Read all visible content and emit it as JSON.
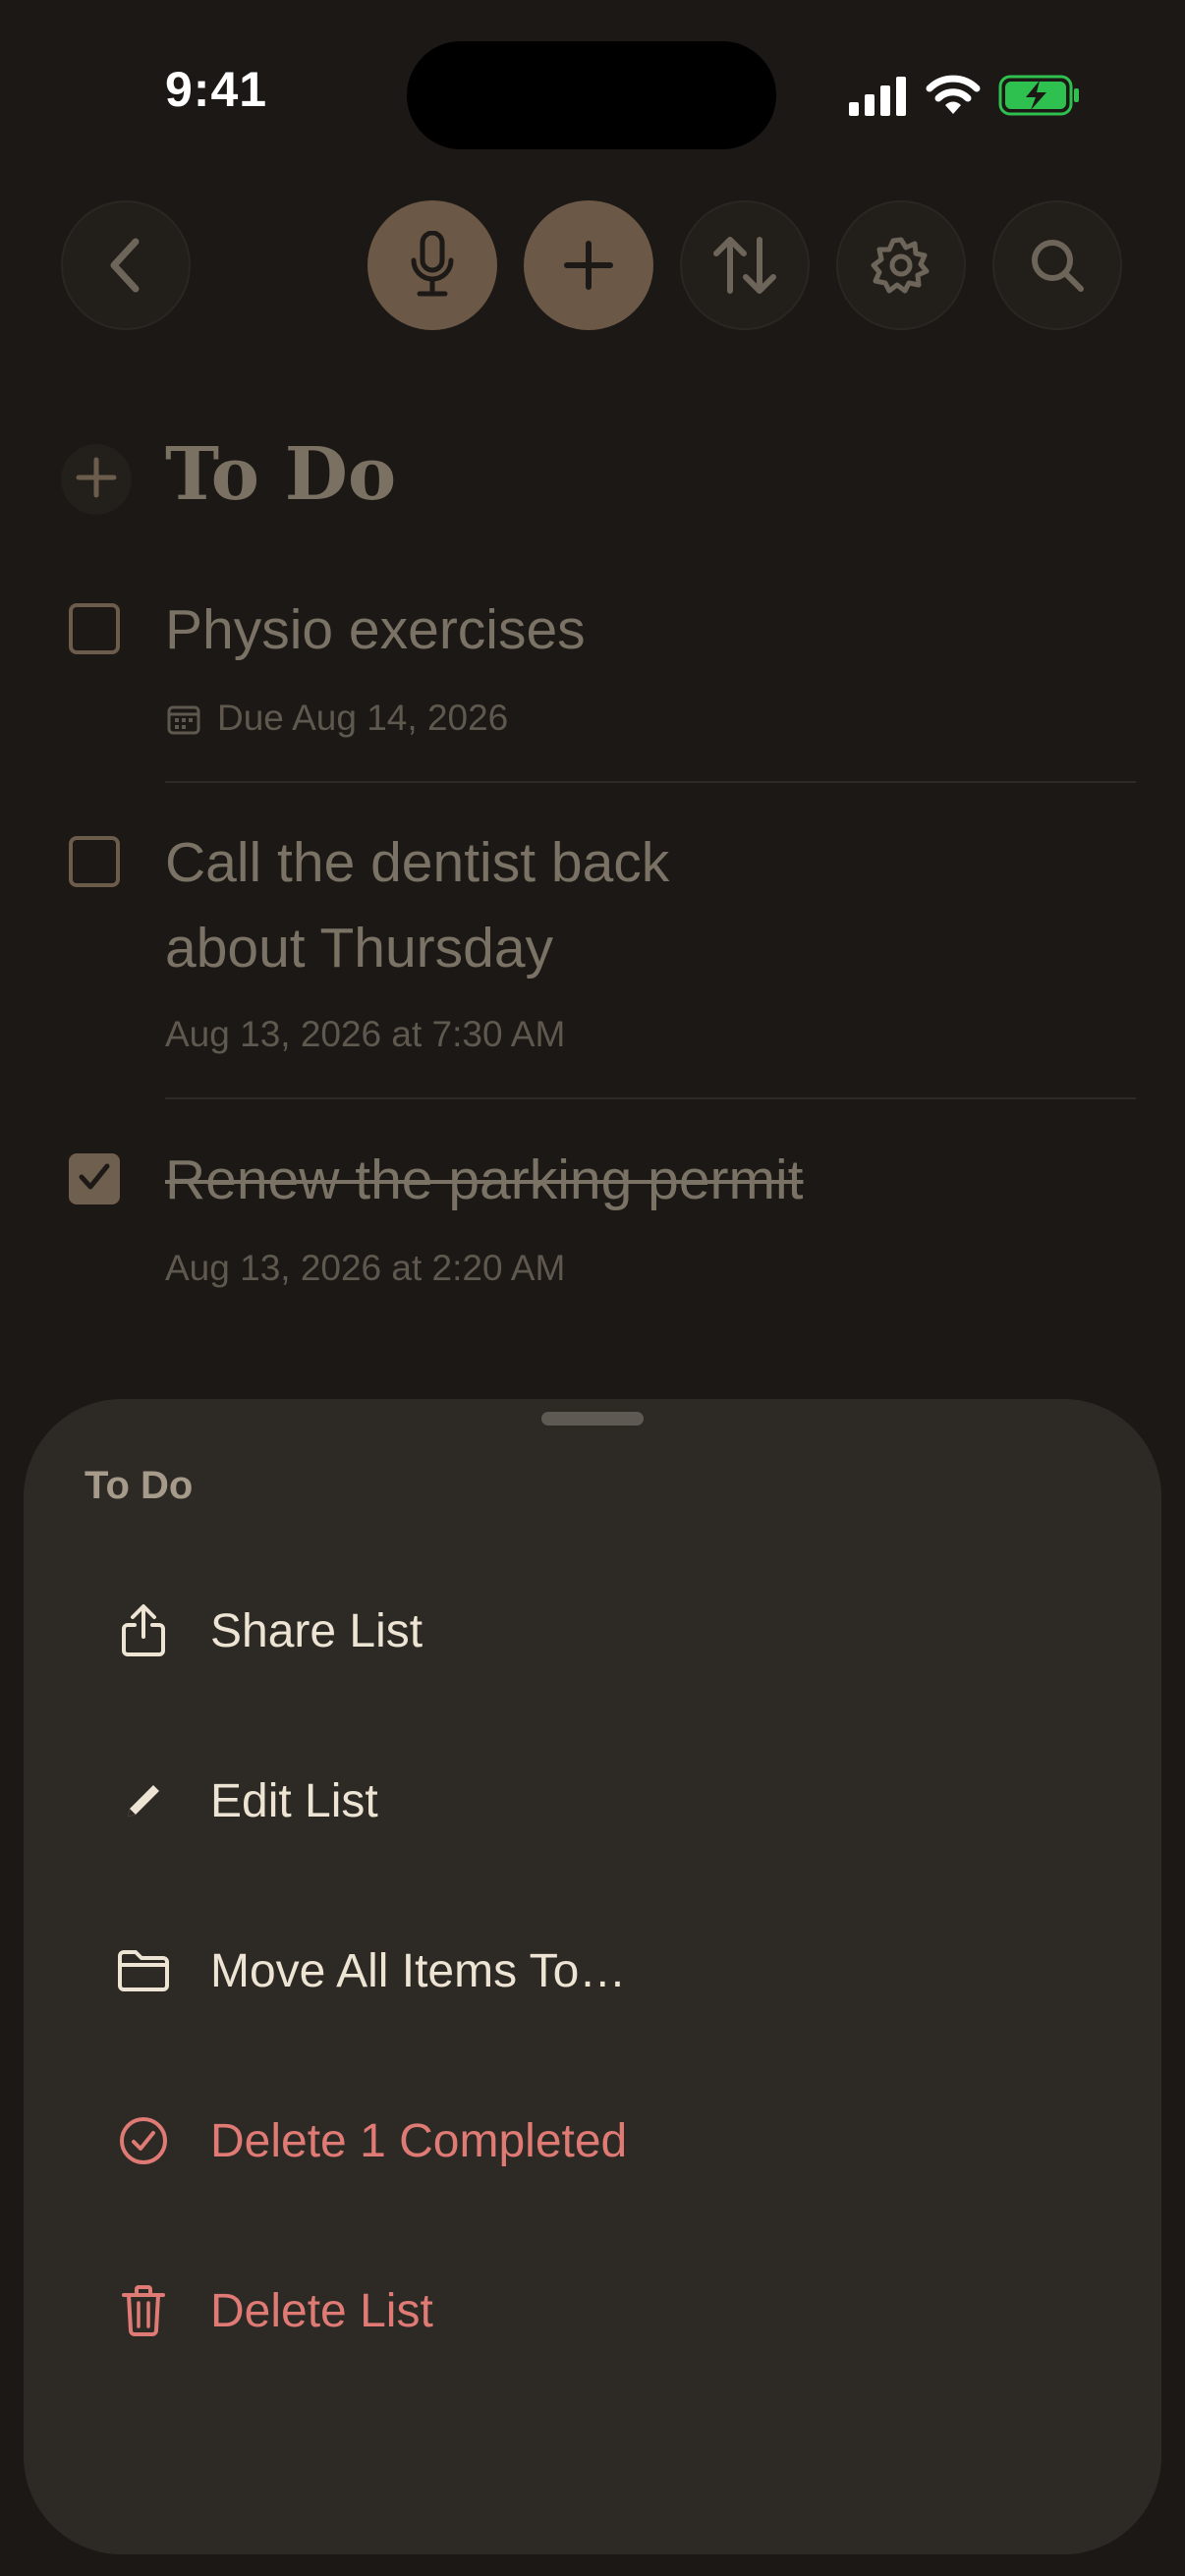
{
  "status_bar": {
    "time": "9:41"
  },
  "toolbar": {
    "buttons": [
      "back",
      "voice",
      "add",
      "sort",
      "settings",
      "search"
    ]
  },
  "list": {
    "title": "To Do",
    "items": [
      {
        "title": "Physio exercises",
        "subtitle": "Due Aug 14, 2026",
        "checked": false
      },
      {
        "title_line1": "Call the dentist back",
        "title_line2": "about Thursday",
        "subtitle": "Aug 13, 2026 at 7:30 AM",
        "checked": false
      },
      {
        "title": "Renew the parking permit",
        "subtitle": "Aug 13, 2026 at 2:20 AM",
        "checked": true
      }
    ]
  },
  "sheet": {
    "title": "To Do",
    "actions": [
      {
        "label": "Share List",
        "icon": "share-icon"
      },
      {
        "label": "Edit List",
        "icon": "pencil-icon"
      },
      {
        "label": "Move All Items To…",
        "icon": "folder-icon"
      },
      {
        "label": "Delete 1 Completed",
        "icon": "checkmark-circle-icon"
      },
      {
        "label": "Delete List",
        "icon": "trash-icon"
      }
    ]
  },
  "colors": {
    "background": "#1b1815",
    "accent": "#6b5846",
    "sheet": "#2d2a26",
    "danger": "#df7a74",
    "battery": "#2fc14f"
  }
}
